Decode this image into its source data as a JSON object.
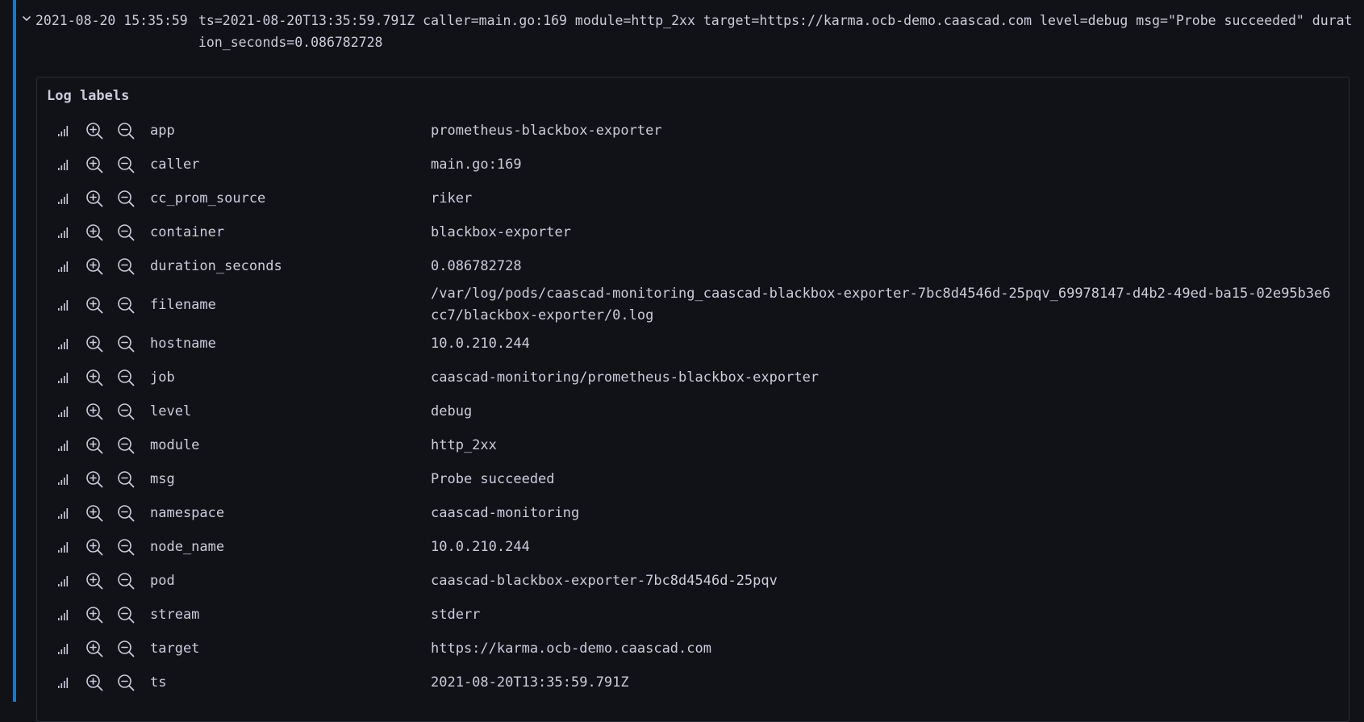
{
  "log_entry": {
    "timestamp": "2021-08-20 15:35:59",
    "message": "ts=2021-08-20T13:35:59.791Z caller=main.go:169 module=http_2xx target=https://karma.ocb-demo.caascad.com level=debug msg=\"Probe succeeded\" duration_seconds=0.086782728"
  },
  "details": {
    "title": "Log labels",
    "labels": [
      {
        "key": "app",
        "value": "prometheus-blackbox-exporter"
      },
      {
        "key": "caller",
        "value": "main.go:169"
      },
      {
        "key": "cc_prom_source",
        "value": "riker"
      },
      {
        "key": "container",
        "value": "blackbox-exporter"
      },
      {
        "key": "duration_seconds",
        "value": "0.086782728"
      },
      {
        "key": "filename",
        "value": "/var/log/pods/caascad-monitoring_caascad-blackbox-exporter-7bc8d4546d-25pqv_69978147-d4b2-49ed-ba15-02e95b3e6cc7/blackbox-exporter/0.log"
      },
      {
        "key": "hostname",
        "value": "10.0.210.244"
      },
      {
        "key": "job",
        "value": "caascad-monitoring/prometheus-blackbox-exporter"
      },
      {
        "key": "level",
        "value": "debug"
      },
      {
        "key": "module",
        "value": "http_2xx"
      },
      {
        "key": "msg",
        "value": "Probe succeeded"
      },
      {
        "key": "namespace",
        "value": "caascad-monitoring"
      },
      {
        "key": "node_name",
        "value": "10.0.210.244"
      },
      {
        "key": "pod",
        "value": "caascad-blackbox-exporter-7bc8d4546d-25pqv"
      },
      {
        "key": "stream",
        "value": "stderr"
      },
      {
        "key": "target",
        "value": "https://karma.ocb-demo.caascad.com"
      },
      {
        "key": "ts",
        "value": "2021-08-20T13:35:59.791Z"
      }
    ]
  },
  "icons": {
    "expand": "chevron-down-icon",
    "stats": "signal-bars-icon",
    "filter_for": "zoom-in-icon",
    "filter_out": "zoom-out-icon"
  },
  "colors": {
    "background": "#111217",
    "text": "#ccccdc",
    "accent_bar": "#1f78c1",
    "border": "#2a2d33"
  }
}
